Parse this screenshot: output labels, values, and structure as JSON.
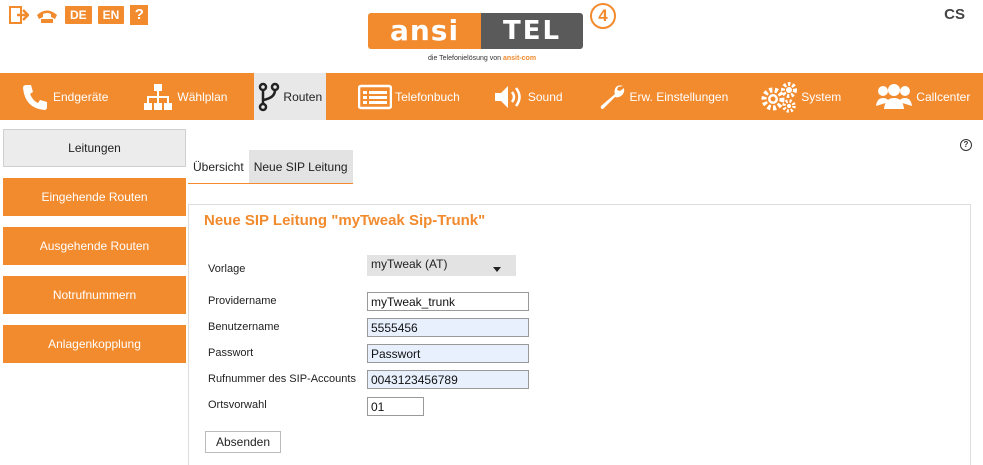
{
  "header": {
    "lang_de": "DE",
    "lang_en": "EN",
    "help": "?",
    "logo_left": "ansi",
    "logo_right": "TEL",
    "logo_version": "4",
    "logo_sub": "die Telefonielösung von",
    "logo_sub_brand": "ansit-com",
    "cs_label": "CS"
  },
  "nav": [
    {
      "label": "Endgeräte",
      "icon": "phone-icon"
    },
    {
      "label": "Wählplan",
      "icon": "sitemap-icon"
    },
    {
      "label": "Routen",
      "icon": "routes-icon"
    },
    {
      "label": "Telefonbuch",
      "icon": "phonebook-icon"
    },
    {
      "label": "Sound",
      "icon": "speaker-icon"
    },
    {
      "label": "Erw. Einstellungen",
      "icon": "wrench-icon"
    },
    {
      "label": "System",
      "icon": "gears-icon"
    },
    {
      "label": "Callcenter",
      "icon": "users-icon"
    }
  ],
  "sidebar": {
    "items": [
      {
        "label": "Leitungen"
      },
      {
        "label": "Eingehende Routen"
      },
      {
        "label": "Ausgehende Routen"
      },
      {
        "label": "Notrufnummern"
      },
      {
        "label": "Anlagenkopplung"
      }
    ]
  },
  "tabs": [
    {
      "label": "Übersicht"
    },
    {
      "label": "Neue SIP Leitung"
    }
  ],
  "form": {
    "title": "Neue SIP Leitung \"myTweak Sip-Trunk\"",
    "vorlage_label": "Vorlage",
    "vorlage_value": "myTweak (AT)",
    "providername_label": "Providername",
    "providername_value": "myTweak_trunk",
    "benutzername_label": "Benutzername",
    "benutzername_value": "5555456",
    "passwort_label": "Passwort",
    "passwort_value": "Passwort",
    "rufnummer_label": "Rufnummer des SIP-Accounts",
    "rufnummer_value": "0043123456789",
    "ortsvorwahl_label": "Ortsvorwahl",
    "ortsvorwahl_value": "01",
    "submit_label": "Absenden"
  },
  "colors": {
    "accent": "#f28a2e",
    "logo_dark": "#5a5a5a",
    "autofill": "#e8f0fe"
  }
}
